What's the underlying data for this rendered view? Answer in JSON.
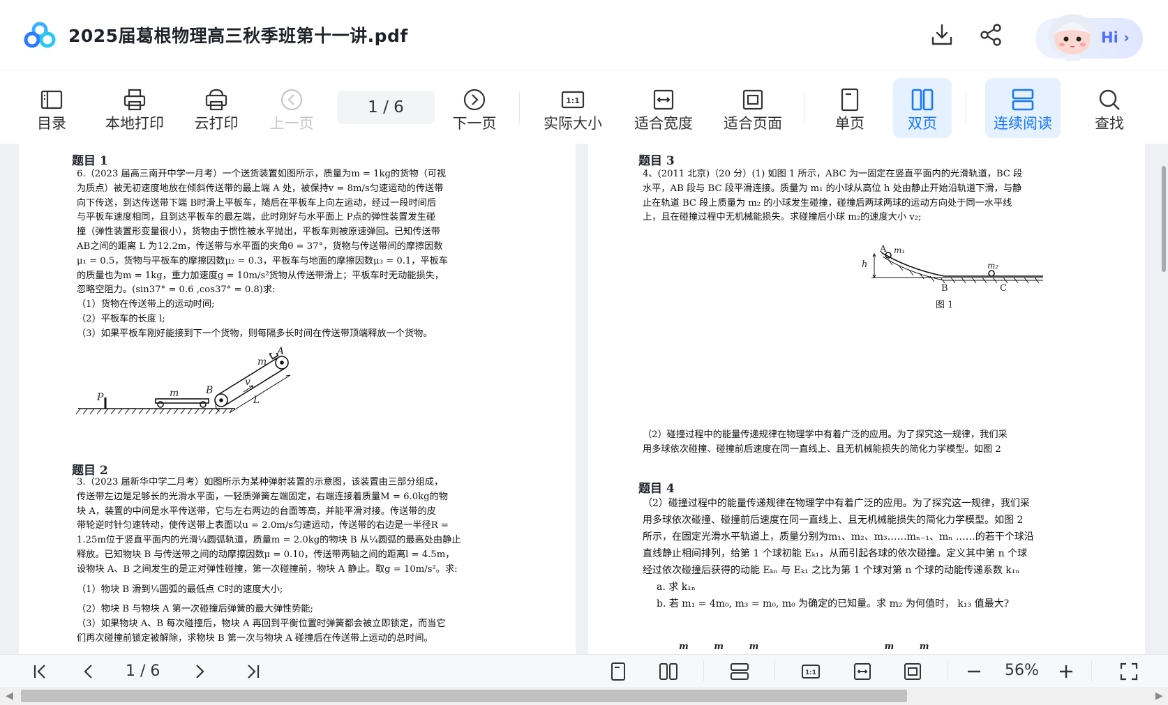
{
  "header": {
    "title": "2025届葛根物理高三秋季班第十一讲.pdf",
    "hi_label": "Hi",
    "icons": [
      "download-icon",
      "share-icon"
    ]
  },
  "toolbar": {
    "catalog": "目录",
    "local_print": "本地打印",
    "cloud_print": "云打印",
    "prev_page": "上一页",
    "page_indicator": "1  / 6",
    "next_page": "下一页",
    "actual_size": "实际大小",
    "fit_width": "适合宽度",
    "fit_page": "适合页面",
    "single_page": "单页",
    "double_page": "双页",
    "continuous": "连续阅读",
    "search": "查找"
  },
  "colors": {
    "accent": "#1677ff",
    "active_bg": "#e6f1ff",
    "disabled": "#c4c6cc"
  },
  "document": {
    "left": {
      "q1_head": "题目 1",
      "q1": [
        "6.（2023 届高三南开中学一月考）一个送货装置如图所示，质量为m = 1kg的货物（可视",
        "为质点）被无初速度地放在倾斜传送带的最上端 A 处，被保持v = 8m/s匀速运动的传送带",
        "向下传送，到达传送带下端 B时滑上平板车，随后在平板车上向左运动，经过一段时间后",
        "与平板车速度相同，且到达平板车的最左端，此时刚好与水平面上 P点的弹性装置发生碰",
        "撞（弹性装置形变量很小），货物由于惯性被水平抛出，平板车则被原速弹回。已知传送带",
        "AB之间的距离 L 为12.2m，传送带与水平面的夹角θ = 37°，货物与传送带间的摩擦因数",
        "μ₁ = 0.5，货物与平板车的摩擦因数μ₂ = 0.3，平板车与地面的摩擦因数μ₃ = 0.1，平板车",
        "的质量也为m = 1kg，重力加速度g = 10m/s²货物从传送带滑上；平板车时无动能损失，",
        "忽略空阻力。(sin37° = 0.6 ,cos37° = 0.8)求:",
        "（1）货物在传送带上的运动时间;",
        "（2）平板车的长度 l;",
        "（3）如果平板车刚好能接到下一个货物，则每隔多长时间在传送带顶端释放一个货物。"
      ],
      "fig1_labels": {
        "m_a": "m",
        "a": "A",
        "b": "B",
        "p": "P",
        "m": "m",
        "v": "v",
        "l": "L"
      },
      "q2_head": "题目 2",
      "q2": [
        "3.（2023 届新华中学二月考）如图所示为某种弹射装置的示意图，该装置由三部分组成，",
        "传送带左边是足够长的光滑水平面，一轻质弹簧左端固定，右端连接着质量M = 6.0kg的物",
        "块 A，装置的中间是水平传送带，它与左右两边的台面等高，并能平滑对接。传送带的皮",
        "带轮逆时针匀速转动，使传送带上表面以u = 2.0m/s匀速运动，传送带的右边是一半径R =",
        "1.25m位于竖直平面内的光滑¼圆弧轨道，质量m = 2.0kg的物块 B 从¼圆弧的最高处由静止",
        "释放。已知物块 B 与传送带之间的动摩擦因数μ = 0.10，传送带两轴之间的距离l = 4.5m，",
        "设物块 A、B 之间发生的是正对弹性碰撞，第一次碰撞前，物块 A 静止。取g = 10m/s²。求:",
        "（1）物块 B 滑到¼圆弧的最低点 C时的速度大小;",
        "（2）物块 B 与物块 A 第一次碰撞后弹簧的最大弹性势能;",
        "（3）如果物块 A、B 每次碰撞后，物块 A 再回到平衡位置时弹簧都会被立即锁定，而当它",
        "们再次碰撞前锁定被解除，求物块 B 第一次与物块 A 碰撞后在传送带上运动的总时间。"
      ]
    },
    "right": {
      "q3_head": "题目 3",
      "q3": [
        "4、(2011 北京)（20 分）(1) 如图 1 所示，ABC 为一固定在竖直平面内的光滑轨道，BC 段",
        "水平，AB 段与 BC 段平滑连接。质量为 m₁ 的小球从高位 h 处由静止开始沿轨道下滑，与静",
        "止在轨道 BC 段上质量为 m₂ 的小球发生碰撞，碰撞后两球两球的运动方向处于同一水平线",
        "上，且在碰撞过程中无机械能损失。求碰撞后小球 m₂的速度大小 v₂;"
      ],
      "fig2_labels": {
        "a": "A",
        "m1": "m₁",
        "h": "h",
        "m2": "m₂",
        "b": "B",
        "c": "C",
        "caption": "图 1"
      },
      "q3b": [
        "（2）碰撞过程中的能量传递规律在物理学中有着广泛的应用。为了探究这一规律，我们采",
        "用多球依次碰撞、碰撞前后速度在同一直线上、且无机械能损失的简化力学模型。如图 2"
      ],
      "q4_head": "题目 4",
      "q4": [
        "（2）碰撞过程中的能量传递规律在物理学中有着广泛的应用。为了探究这一规律，我们采",
        "用多球依次碰撞、碰撞前后速度在同一直线上、且无机械能损失的简化力学模型。如图 2",
        "所示，在固定光滑水平轨道上，质量分别为m₁、m₂、m₃……mₙ₋₁、mₙ ……的若干个球沿",
        "直线静止相间排列，给第 1 个球初能 Eₖ₁，从而引起各球的依次碰撞。定义其中第 n 个球",
        "经过依次碰撞后获得的动能 Eₖₙ 与 Eₖ₁ 之比为第 1 个球对第 n 个球的动能传递系数 k₁ₙ",
        "a. 求 k₁ₙ",
        "b. 若 m₁ = 4m₀, m₃ = m₀, m₀ 为确定的已知量。求 m₂ 为何值时， k₁₃ 值最大?"
      ]
    }
  },
  "bottom": {
    "page_indicator": "1 / 6",
    "zoom": "56%"
  }
}
